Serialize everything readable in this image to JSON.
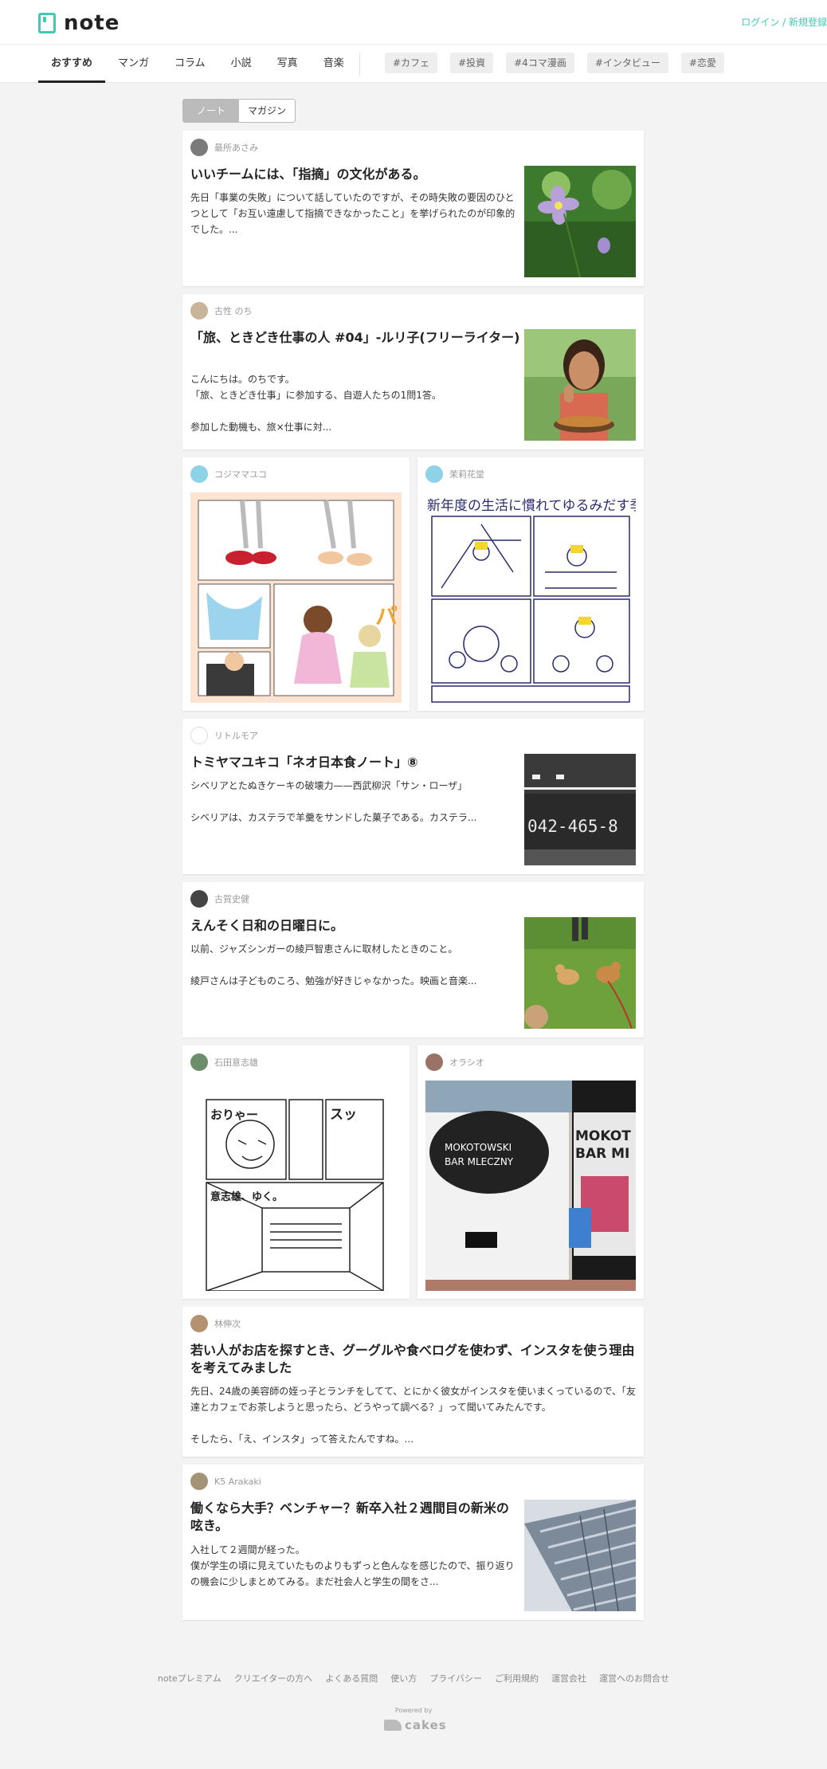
{
  "header": {
    "logo_text": "note",
    "login_label": "ログイン",
    "auth_sep": " / ",
    "signup_label": "新規登録"
  },
  "nav": {
    "tabs": [
      "おすすめ",
      "マンガ",
      "コラム",
      "小説",
      "写真",
      "音楽"
    ],
    "tags": [
      "#カフェ",
      "#投資",
      "#4コマ漫画",
      "#インタビュー",
      "#恋愛"
    ]
  },
  "toggle": {
    "note_label": "ノート",
    "magazine_label": "マガジン"
  },
  "posts": [
    {
      "author": "最所あさみ",
      "title": "いいチームには、「指摘」の文化がある。",
      "excerpt": "先日「事業の失敗」について話していたのですが、その時失敗の要因のひとつとして「お互い遠慮して指摘できなかったこと」を挙げられたのが印象的でした。..."
    },
    {
      "author": "古性 のち",
      "title": "「旅、ときどき仕事の人 #04」-ルリ子(フリーライター)",
      "excerpt_lines": [
        "こんにちは。のちです。",
        "「旅、ときどき仕事」に参加する、自遊人たちの1問1答。",
        "",
        "参加した動機も、旅×仕事に対..."
      ]
    },
    {
      "author": "コジママユコ"
    },
    {
      "author": "茉莉花堂",
      "manga_title": "新年度の生活に慣れてゆるみだす季節"
    },
    {
      "author": "リトルモア",
      "title": "トミヤマユキコ「ネオ日本食ノート」⑧",
      "excerpt_lines": [
        "シベリアとたぬきケーキの破壊力——西武柳沢「サン・ローザ」",
        "",
        "シベリアは、カステラで羊羹をサンドした菓子である。カステラ..."
      ],
      "thumb_text": "042-465-8"
    },
    {
      "author": "古賀史健",
      "title": "えんそく日和の日曜日に。",
      "excerpt_lines": [
        "以前、ジャズシンガーの綾戸智恵さんに取材したときのこと。",
        "",
        "綾戸さんは子どものころ、勉強が好きじゃなかった。映画と音楽..."
      ]
    },
    {
      "author": "石田意志雄",
      "comic_text": "意志雄、ゆく。",
      "comic_sfx": [
        "おりゃー",
        "スッ"
      ]
    },
    {
      "author": "オラシオ",
      "sign_text": [
        "MOKOTOWSKI",
        "BAR MLECZNY"
      ],
      "sign_text2": [
        "MOKOT",
        "BAR MI"
      ]
    },
    {
      "author": "林伸次",
      "title": "若い人がお店を探すとき、グーグルや食べログを使わず、インスタを使う理由を考えてみました",
      "excerpt_lines": [
        "先日、24歳の美容師の姪っ子とランチをしてて、とにかく彼女がインスタを使いまくっているので、「友達とカフェでお茶しようと思ったら、どうやって調べる？」って聞いてみたんです。",
        "",
        "そしたら、「え、インスタ」って答えたんですね。..."
      ]
    },
    {
      "author": "K5 Arakaki",
      "title": "働くなら大手？ベンチャー？新卒入社２週間目の新米の呟き。",
      "excerpt_lines": [
        "入社して２週間が経った。",
        "僕が学生の頃に見えていたものよりもずっと色んなを感じたので、振り返りの機会に少しまとめてみる。まだ社会人と学生の間をさ..."
      ]
    }
  ],
  "footer": {
    "links": [
      "noteプレミアム",
      "クリエイターの方へ",
      "よくある質問",
      "使い方",
      "プライバシー",
      "ご利用規約",
      "運営会社",
      "運営へのお問合せ"
    ],
    "powered_by": "Powered by",
    "cakes": "cakes"
  },
  "colors": {
    "accent": "#41c9b4",
    "background": "#f3f3f3"
  }
}
